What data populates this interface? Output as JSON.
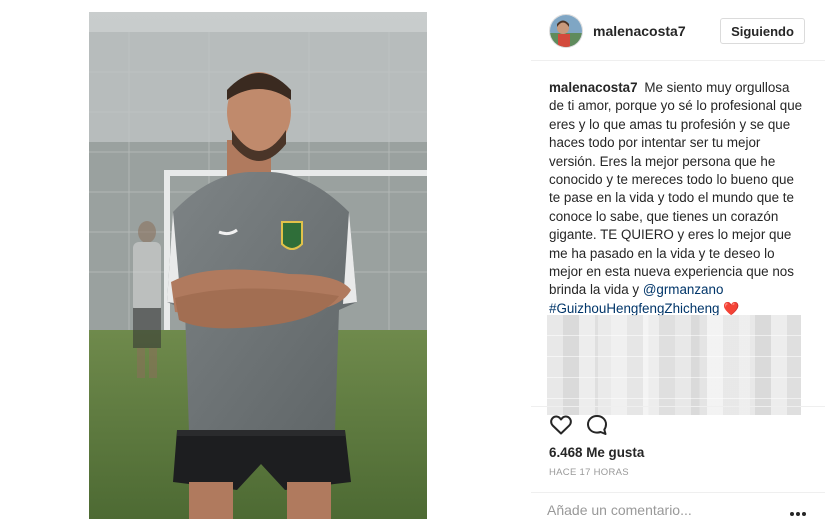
{
  "post": {
    "username": "malenacosta7",
    "follow_label": "Siguiendo",
    "caption_author": "malenacosta7",
    "caption_text": "Me siento muy orgullosa de ti amor, porque yo sé lo profesional que eres y lo que amas tu profesión y se que haces todo por intentar ser tu mejor versión. Eres la mejor persona que he conocido y te mereces todo lo bueno que te pase en la vida y todo el mundo que te conoce lo sabe, que tienes un corazón gigante. TE QUIERO y eres lo mejor que me ha pasado en la vida y te deseo lo mejor en esta nueva experiencia que nos brinda la vida y",
    "mention": "@grmanzano",
    "hashtag": "#GuizhouHengfengZhicheng",
    "emoji": "❤️",
    "likes": "6.468 Me gusta",
    "timestamp": "HACE 17 HORAS",
    "comment_placeholder": "Añade un comentario..."
  },
  "colors": {
    "link": "#003569",
    "muted": "#999999",
    "border": "#dbdbdb",
    "text": "#262626"
  },
  "icons": {
    "like": "heart-outline-icon",
    "comment": "speech-bubble-icon",
    "more": "ellipsis-icon"
  }
}
